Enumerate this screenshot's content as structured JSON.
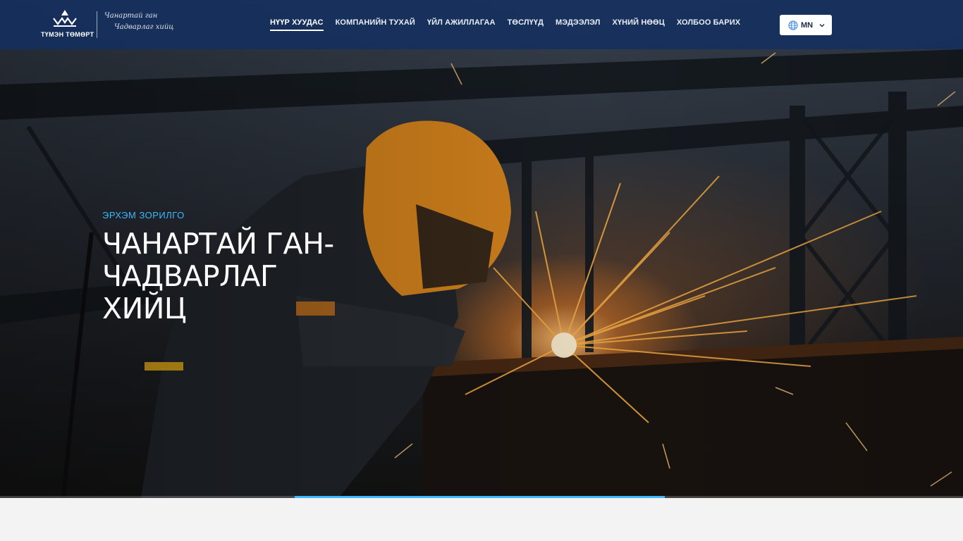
{
  "brand": {
    "name": "ТҮМЭН ТӨМӨРТ",
    "slogan_line1": "Чанартай ган",
    "slogan_line2": "Чадварлаг хийц"
  },
  "nav": {
    "items": [
      {
        "label": "НҮҮР ХУУДАС",
        "active": true
      },
      {
        "label": "КОМПАНИЙН ТУХАЙ",
        "active": false
      },
      {
        "label": "ҮЙЛ АЖИЛЛАГАА",
        "active": false
      },
      {
        "label": "ТӨСЛҮҮД",
        "active": false
      },
      {
        "label": "МЭДЭЭЛЭЛ",
        "active": false
      },
      {
        "label": "ХҮНИЙ НӨӨЦ",
        "active": false
      },
      {
        "label": "ХОЛБОО БАРИХ",
        "active": false
      }
    ]
  },
  "language": {
    "current": "MN",
    "icon": "globe-icon"
  },
  "hero": {
    "eyebrow": "ЭРХЭМ ЗОРИЛГО",
    "title_line1": "ЧАНАРТАЙ ГАН-ЧАДВАРЛАГ",
    "title_line2": "ХИЙЦ",
    "slide_progress": 0.385
  },
  "colors": {
    "header_bg": "#14305f",
    "accent": "#3db7ff",
    "text_light": "#ffffff"
  }
}
